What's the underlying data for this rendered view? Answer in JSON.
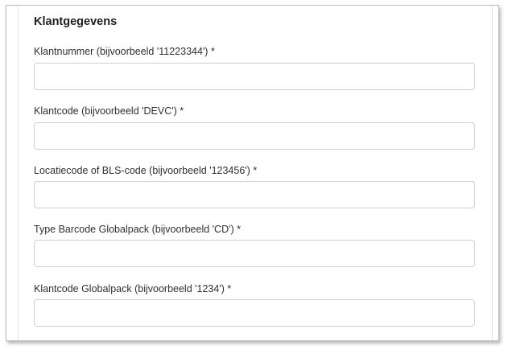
{
  "section": {
    "title": "Klantgegevens"
  },
  "fields": [
    {
      "label": "Klantnummer (bijvoorbeeld '11223344') *",
      "value": "",
      "placeholder": ""
    },
    {
      "label": "Klantcode (bijvoorbeeld 'DEVC') *",
      "value": "",
      "placeholder": ""
    },
    {
      "label": "Locatiecode of BLS-code (bijvoorbeeld '123456') *",
      "value": "",
      "placeholder": ""
    },
    {
      "label": "Type Barcode Globalpack (bijvoorbeeld 'CD') *",
      "value": "",
      "placeholder": ""
    },
    {
      "label": "Klantcode Globalpack (bijvoorbeeld '1234') *",
      "value": "",
      "placeholder": ""
    }
  ]
}
